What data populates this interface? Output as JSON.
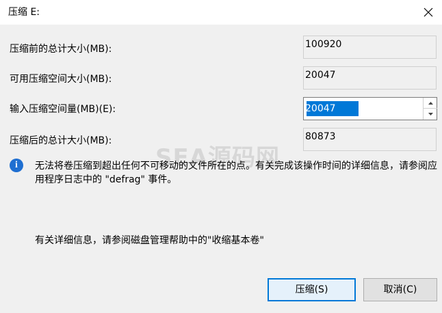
{
  "window": {
    "title": "压缩 E:",
    "close_icon": "close-icon"
  },
  "fields": {
    "total_before_label": "压缩前的总计大小(MB):",
    "total_before_value": "100920",
    "available_label": "可用压缩空间大小(MB):",
    "available_value": "20047",
    "input_label": "输入压缩空间量(MB)(E):",
    "input_value": "20047",
    "total_after_label": "压缩后的总计大小(MB):",
    "total_after_value": "80873"
  },
  "info": {
    "icon": "info-icon",
    "text": "无法将卷压缩到超出任何不可移动的文件所在的点。有关完成该操作时间的详细信息，请参阅应用程序日志中的 \"defrag\" 事件。",
    "more": "有关详细信息，请参阅磁盘管理帮助中的\"收缩基本卷\""
  },
  "buttons": {
    "shrink": "压缩(S)",
    "cancel": "取消(C)"
  },
  "watermark": "SEA源码网",
  "colors": {
    "accent": "#0078d7",
    "info": "#1f6fd1",
    "background": "#f0f0f0"
  }
}
